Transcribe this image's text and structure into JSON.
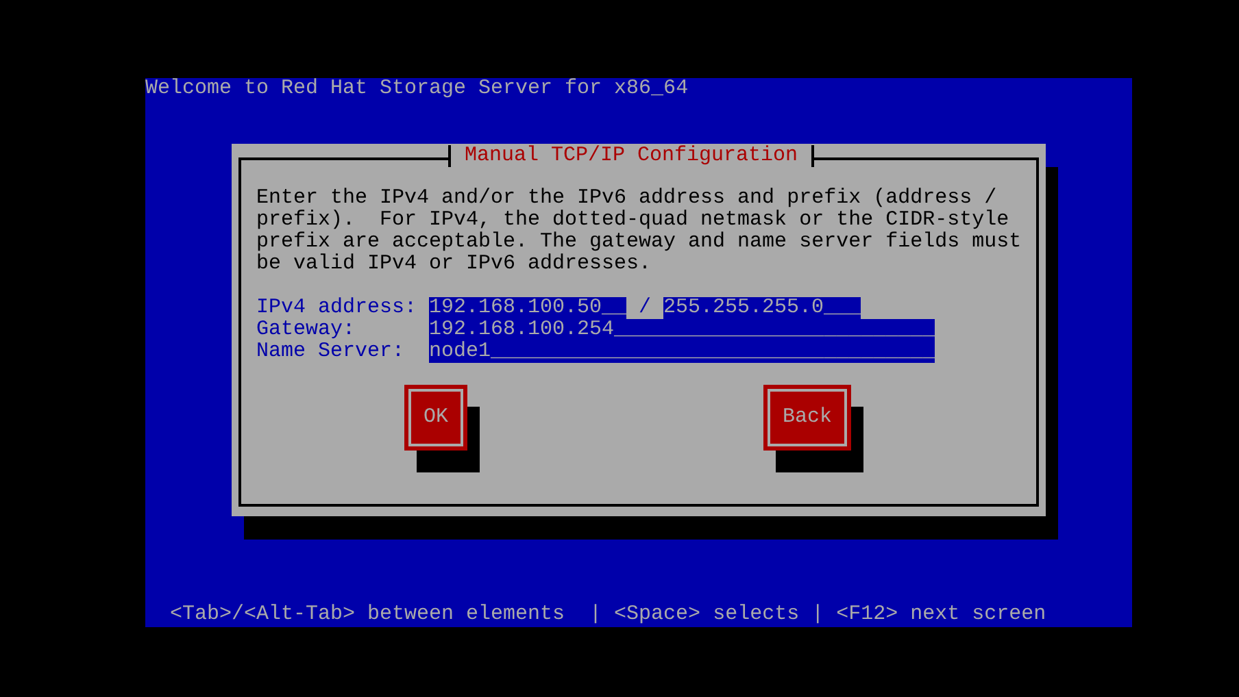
{
  "screen_title": "Welcome to Red Hat Storage Server for x86_64",
  "dialog": {
    "title": "Manual TCP/IP Configuration",
    "description": "Enter the IPv4 and/or the IPv6 address and prefix (address /\nprefix).  For IPv4, the dotted-quad netmask or the CIDR-style\nprefix are acceptable. The gateway and name server fields must\nbe valid IPv4 or IPv6 addresses.",
    "fields": [
      {
        "kind": "address_prefix",
        "label": "IPv4 address:",
        "value": "192.168.100.50__",
        "separator": "/",
        "prefix_value": "255.255.255.0___"
      },
      {
        "kind": "text",
        "label": "Gateway:",
        "value": "192.168.100.254__________________________"
      },
      {
        "kind": "text",
        "label": "Name Server:",
        "value": "node1____________________________________"
      }
    ],
    "buttons": [
      {
        "label": "OK"
      },
      {
        "label": "Back"
      }
    ]
  },
  "help_line": "<Tab>/<Alt-Tab> between elements  | <Space> selects | <F12> next screen"
}
